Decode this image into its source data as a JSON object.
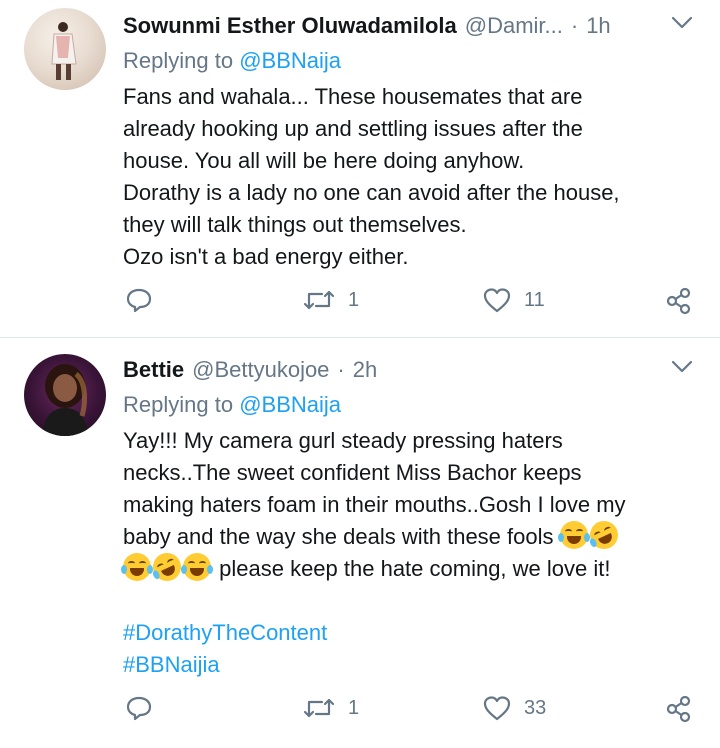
{
  "tweets": [
    {
      "name": "Sowunmi Esther Oluwadamilola",
      "handle": "@Damir...",
      "time": "1h",
      "reply_prefix": "Replying to",
      "reply_to": "@BBNaija",
      "lines": [
        "Fans and wahala... These housemates that are",
        "already hooking up and settling issues after the",
        "house. You all will be here doing anyhow.",
        "Dorathy is a lady no one can avoid after the house,",
        "they will talk things out themselves.",
        "Ozo isn't a bad energy either."
      ],
      "retweets": "1",
      "likes": "11"
    },
    {
      "name": "Bettie",
      "handle": "@Bettyukojoe",
      "time": "2h",
      "reply_prefix": "Replying to",
      "reply_to": "@BBNaija",
      "lines": [
        "Yay!!! My camera gurl steady pressing haters",
        "necks..The sweet confident Miss Bachor keeps",
        "making haters foam in their mouths..Gosh I love my",
        "baby and the way she deals with these fools",
        "please keep the hate coming, we love it!"
      ],
      "hashtags": [
        "#DorathyTheContent",
        "#BBNaijia"
      ],
      "retweets": "1",
      "likes": "33"
    }
  ],
  "separator": "·",
  "icons": [
    "chevron-down-icon",
    "reply-icon",
    "retweet-icon",
    "like-icon",
    "share-icon",
    "emoji-joy-icon",
    "emoji-rofl-icon"
  ],
  "colors": {
    "accent": "#1da1f2",
    "muted": "#657786",
    "text": "#14171a",
    "divider": "#e1e8ed"
  }
}
